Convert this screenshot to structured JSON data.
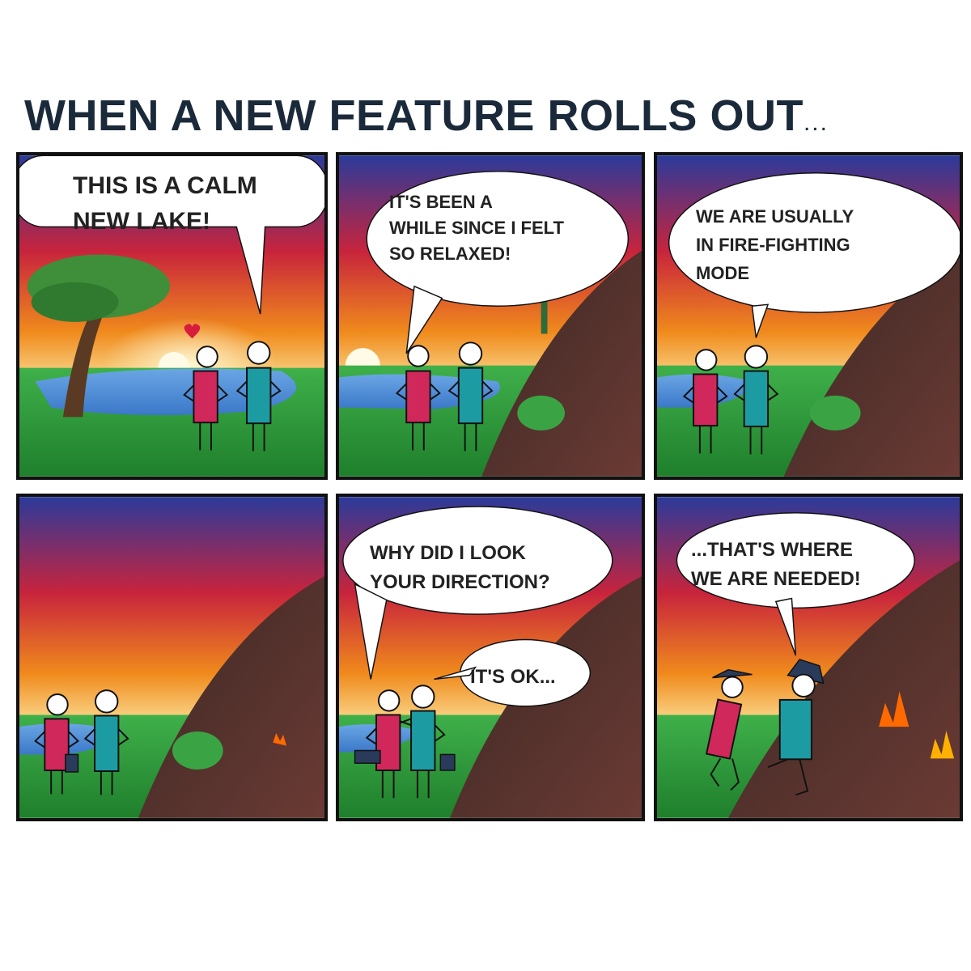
{
  "title": {
    "text": "WHEN A NEW FEATURE ROLLS OUT",
    "ellipsis": "..."
  },
  "panels": [
    {
      "bubble_lines": [
        "THIS IS A CALM",
        "NEW LAKE!"
      ]
    },
    {
      "bubble_lines": [
        "IT'S BEEN A",
        "WHILE SINCE I FELT",
        "SO RELAXED!"
      ]
    },
    {
      "bubble_lines": [
        "WE ARE USUALLY",
        "IN FIRE-FIGHTING",
        "MODE"
      ]
    },
    {
      "bubble_lines": []
    },
    {
      "bubble_lines": [
        "WHY DID I LOOK",
        "YOUR DIRECTION?"
      ],
      "bubble2_lines": [
        "IT'S OK..."
      ]
    },
    {
      "bubble_lines": [
        "...THAT'S WHERE",
        "WE ARE NEEDED!"
      ]
    }
  ],
  "colors": {
    "pink_character": "#d0285a",
    "teal_character": "#1d9ba3",
    "sky_top": "#2b3a9a",
    "sky_mid": "#c8243c",
    "sunset": "#f6a21a",
    "grass": "#2c9e3a",
    "lake": "#4f8fd8",
    "fire": "#ff6a00"
  }
}
